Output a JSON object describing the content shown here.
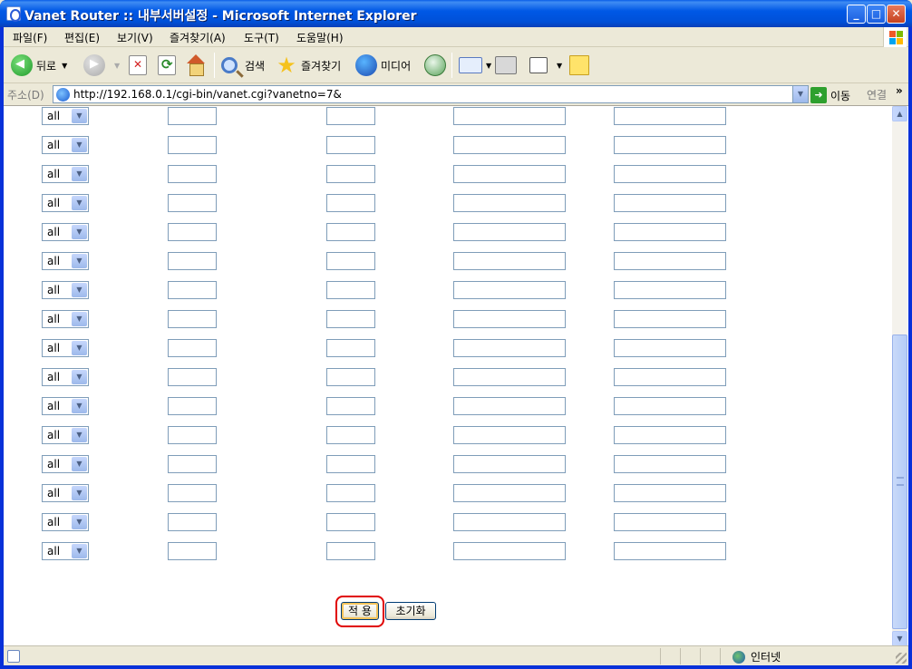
{
  "window": {
    "title": "Vanet Router :: 내부서버설정 - Microsoft Internet Explorer",
    "minimize": "_",
    "maximize": "□",
    "close": "✕"
  },
  "menu": [
    "파일(F)",
    "편집(E)",
    "보기(V)",
    "즐겨찾기(A)",
    "도구(T)",
    "도움말(H)"
  ],
  "toolbar": {
    "back": "뒤로",
    "search": "검색",
    "favorites": "즐겨찾기",
    "media": "미디어"
  },
  "address": {
    "label": "주소(D)",
    "url": "http://192.168.0.1/cgi-bin/vanet.cgi?vanetno=7&",
    "go": "이동",
    "links": "연결",
    "links_more": "»"
  },
  "form": {
    "rows": [
      {
        "protocol": "all"
      },
      {
        "protocol": "all"
      },
      {
        "protocol": "all"
      },
      {
        "protocol": "all"
      },
      {
        "protocol": "all"
      },
      {
        "protocol": "all"
      },
      {
        "protocol": "all"
      },
      {
        "protocol": "all"
      },
      {
        "protocol": "all"
      },
      {
        "protocol": "all"
      },
      {
        "protocol": "all"
      },
      {
        "protocol": "all"
      },
      {
        "protocol": "all"
      },
      {
        "protocol": "all"
      },
      {
        "protocol": "all"
      },
      {
        "protocol": "all"
      }
    ],
    "apply_label": "적 용",
    "reset_label": "초기화"
  },
  "statusbar": {
    "zone": "인터넷"
  }
}
